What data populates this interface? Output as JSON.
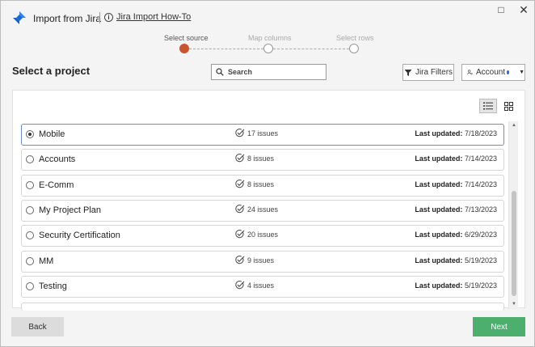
{
  "window": {
    "title": "Import from Jira",
    "help_link": "Jira Import How-To",
    "maximize_glyph": "□",
    "close_glyph": "✕"
  },
  "stepper": {
    "steps": [
      {
        "label": "Select source",
        "active": true
      },
      {
        "label": "Map columns",
        "active": false
      },
      {
        "label": "Select rows",
        "active": false
      }
    ]
  },
  "page": {
    "heading": "Select a project"
  },
  "toolbar": {
    "search_placeholder": "Search",
    "filter_label": "Jira Filters",
    "account_label": "Account"
  },
  "projects": [
    {
      "name": "Mobile",
      "issues": "17 issues",
      "updated_label": "Last updated:",
      "updated_date": "7/18/2023",
      "selected": true
    },
    {
      "name": "Accounts",
      "issues": "8 issues",
      "updated_label": "Last updated:",
      "updated_date": "7/14/2023",
      "selected": false
    },
    {
      "name": "E-Comm",
      "issues": "8 issues",
      "updated_label": "Last updated:",
      "updated_date": "7/14/2023",
      "selected": false
    },
    {
      "name": "My Project Plan",
      "issues": "24 issues",
      "updated_label": "Last updated:",
      "updated_date": "7/13/2023",
      "selected": false
    },
    {
      "name": "Security Certification",
      "issues": "20 issues",
      "updated_label": "Last updated:",
      "updated_date": "6/29/2023",
      "selected": false
    },
    {
      "name": "MM",
      "issues": "9 issues",
      "updated_label": "Last updated:",
      "updated_date": "5/19/2023",
      "selected": false
    },
    {
      "name": "Testing",
      "issues": "4 issues",
      "updated_label": "Last updated:",
      "updated_date": "5/19/2023",
      "selected": false
    }
  ],
  "footer": {
    "back_label": "Back",
    "next_label": "Next"
  },
  "colors": {
    "accent_step": "#c9552e",
    "next_button": "#4caf6d",
    "account_dot": "#1f6fcf",
    "selected_row_border": "#6b8ec9"
  },
  "icons": {
    "app": "jira-logo-icon",
    "help": "info-icon",
    "search": "search-icon",
    "filter": "filter-icon",
    "account": "user-gear-icon",
    "list_view": "list-view-icon",
    "grid_view": "grid-view-icon",
    "issues": "check-circle-icon"
  }
}
